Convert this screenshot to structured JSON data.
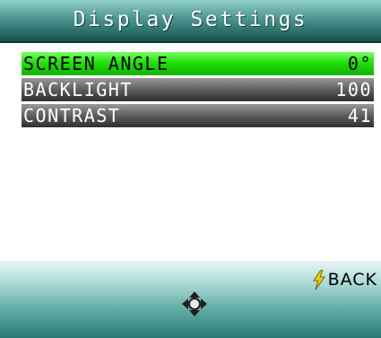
{
  "header": {
    "title": "Display Settings"
  },
  "menu": {
    "items": [
      {
        "label": "SCREEN ANGLE",
        "value": "0°",
        "selected": true
      },
      {
        "label": "BACKLIGHT",
        "value": "100",
        "selected": false
      },
      {
        "label": "CONTRAST",
        "value": "41",
        "selected": false
      }
    ]
  },
  "softkeys": {
    "back_label": "BACK",
    "back_icon": "lightning-bolt-icon",
    "nav_icon": "dpad-icon"
  },
  "colors": {
    "selected_row": "#22e00a",
    "unselected_row": "#5e5e5e",
    "title_bar": "#4d9590",
    "bolt": "#f4d000"
  }
}
